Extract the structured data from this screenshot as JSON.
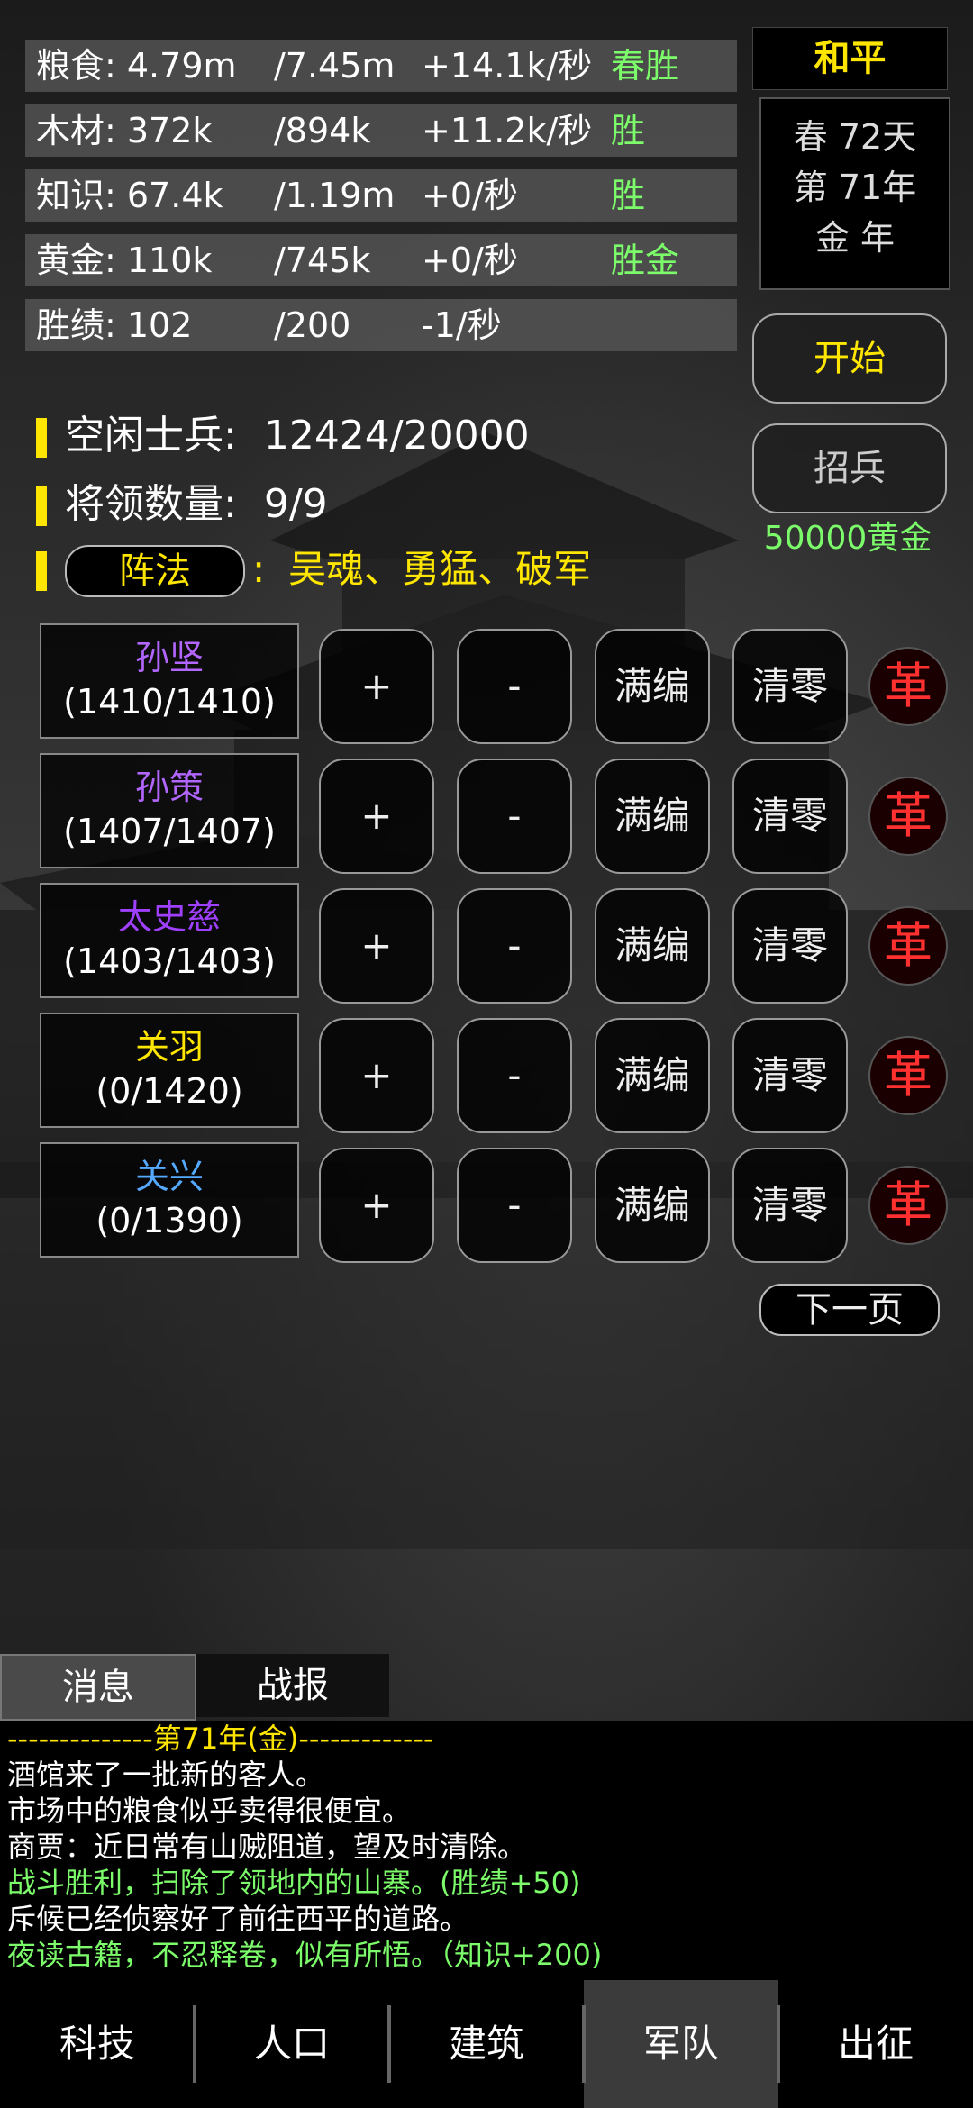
{
  "resources": [
    {
      "name": "粮食: 4.79m",
      "max": "/7.45m",
      "rate": "+14.1k/秒",
      "tag": "春胜"
    },
    {
      "name": "木材: 372k",
      "max": "/894k",
      "rate": "+11.2k/秒",
      "tag": "胜"
    },
    {
      "name": "知识: 67.4k",
      "max": "/1.19m",
      "rate": "+0/秒",
      "tag": "胜"
    },
    {
      "name": "黄金: 110k",
      "max": "/745k",
      "rate": "+0/秒",
      "tag": "胜金"
    },
    {
      "name": "胜绩: 102",
      "max": "/200",
      "rate": "-1/秒",
      "tag": ""
    }
  ],
  "status": "和平",
  "date": {
    "line1": "春 72天",
    "line2": "第 71年",
    "line3": "金 年"
  },
  "buttons": {
    "start": "开始",
    "recruit": "招兵",
    "recruit_cost": "50000黄金",
    "next_page": "下一页"
  },
  "army": {
    "idle_label": "空闲士兵:",
    "idle_value": "12424/20000",
    "generals_label": "将领数量:",
    "generals_value": "9/9",
    "formation_button": "阵法",
    "formation_colon": ":",
    "formation_list": "吴魂、勇猛、破军"
  },
  "row_buttons": {
    "plus": "+",
    "minus": "-",
    "fill": "满编",
    "clear": "清零",
    "revolt": "革"
  },
  "generals": [
    {
      "name": "孙坚",
      "count": "(1410/1410)",
      "color": "#B266FF"
    },
    {
      "name": "孙策",
      "count": "(1407/1407)",
      "color": "#B266FF"
    },
    {
      "name": "太史慈",
      "count": "(1403/1403)",
      "color": "#A040FF"
    },
    {
      "name": "关羽",
      "count": "(0/1420)",
      "color": "#FFE600"
    },
    {
      "name": "关兴",
      "count": "(0/1390)",
      "color": "#55AAFF"
    }
  ],
  "log_tabs": {
    "messages": "消息",
    "reports": "战报"
  },
  "log": [
    {
      "text": "--------------第71年(金)-------------",
      "color": "#FFE600"
    },
    {
      "text": "酒馆来了一批新的客人。",
      "color": "#FFFFFF"
    },
    {
      "text": "市场中的粮食似乎卖得很便宜。",
      "color": "#FFFFFF"
    },
    {
      "text": "商贾：近日常有山贼阻道，望及时清除。",
      "color": "#FFFFFF"
    },
    {
      "text": "战斗胜利，扫除了领地内的山寨。(胜绩+50)",
      "color": "#7CFC6A"
    },
    {
      "text": "斥候已经侦察好了前往西平的道路。",
      "color": "#FFFFFF"
    },
    {
      "text": "夜读古籍，不忍释卷，似有所悟。（知识+200)",
      "color": "#7CFC6A"
    }
  ],
  "nav": [
    "科技",
    "人口",
    "建筑",
    "军队",
    "出征"
  ],
  "nav_active": 3,
  "colors": {
    "accent": "#FFE600",
    "positive": "#7CFC6A",
    "danger": "#FF3030"
  }
}
